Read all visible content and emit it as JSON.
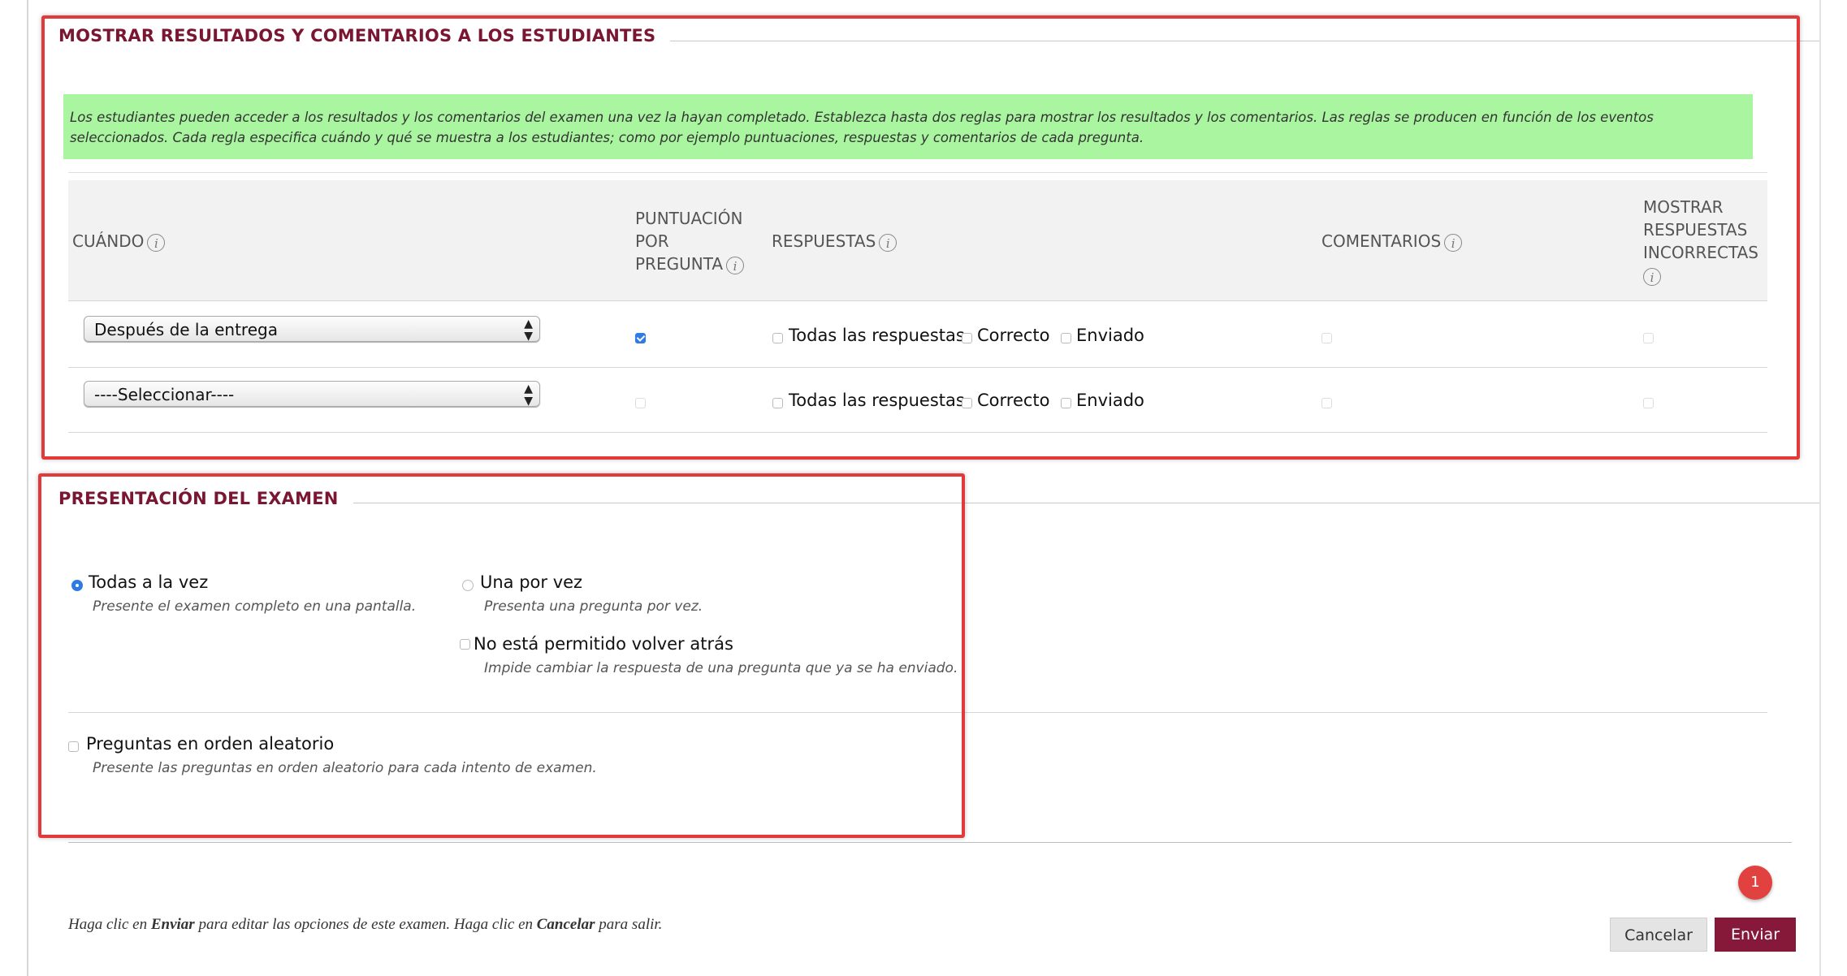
{
  "results_section": {
    "title": "MOSTRAR RESULTADOS Y COMENTARIOS A LOS ESTUDIANTES",
    "note": "Los estudiantes pueden acceder a los resultados y los comentarios del examen una vez la hayan completado. Establezca hasta dos reglas para mostrar los resultados y los comentarios. Las reglas se producen en función de los eventos seleccionados. Cada regla especifica cuándo y qué se muestra a los estudiantes; como por ejemplo puntuaciones, respuestas y comentarios de cada pregunta.",
    "columns": {
      "when": "CUÁNDO",
      "score_l1": "PUNTUACIÓN",
      "score_l2": "POR",
      "score_l3": "PREGUNTA",
      "answers": "RESPUESTAS",
      "comments": "COMENTARIOS",
      "incorrect_l1": "MOSTRAR",
      "incorrect_l2": "RESPUESTAS",
      "incorrect_l3": "INCORRECTAS"
    },
    "info_glyph": "i",
    "rules": [
      {
        "when": "Después de la entrega",
        "score_checked": true,
        "all_answers": "Todas las respuestas",
        "correct": "Correcto",
        "submitted": "Enviado"
      },
      {
        "when": "----Seleccionar----",
        "score_checked": false,
        "all_answers": "Todas las respuestas",
        "correct": "Correcto",
        "submitted": "Enviado"
      }
    ]
  },
  "presentation_section": {
    "title": "PRESENTACIÓN DEL EXAMEN",
    "all_at_once": {
      "label": "Todas a la vez",
      "desc": "Presente el examen completo en una pantalla.",
      "selected": true
    },
    "one_at_a_time": {
      "label": "Una por vez",
      "desc": "Presenta una pregunta por vez.",
      "selected": false
    },
    "no_backtracking": {
      "label": "No está permitido volver atrás",
      "desc": "Impide cambiar la respuesta de una pregunta que ya se ha enviado."
    },
    "randomize": {
      "label": "Preguntas en orden aleatorio",
      "desc": "Presente las preguntas en orden aleatorio para cada intento de examen."
    }
  },
  "footer": {
    "p1": "Haga clic en ",
    "b1": "Enviar",
    "p2": " para editar las opciones de este examen. Haga clic en ",
    "b2": "Cancelar",
    "p3": " para salir.",
    "cancel": "Cancelar",
    "submit": "Enviar",
    "badge": "1"
  },
  "colors": {
    "accent": "#7a1632",
    "submit_button": "#86183a",
    "highlight_box": "#e23a3a",
    "note_background": "#a9f5a0",
    "checkbox_checked": "#2f7be5"
  }
}
